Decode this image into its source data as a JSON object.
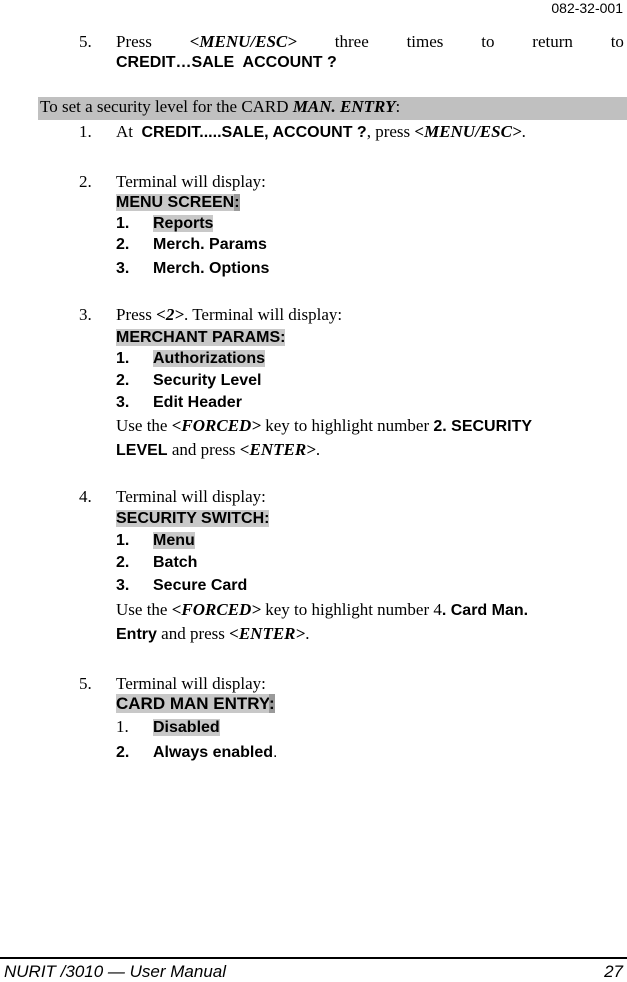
{
  "header": {
    "doc_number": "082-32-001"
  },
  "intro_step": {
    "number": "5.",
    "words": [
      "Press",
      "<MENU/ESC>",
      "three",
      "times",
      "to",
      "return",
      "to"
    ],
    "target": "CREDIT…SALE  ACCOUNT ?"
  },
  "section_banner": {
    "prefix": "To set a security level for the CARD ",
    "emphasis": "MAN. ENTRY",
    "suffix": ":"
  },
  "steps": [
    {
      "number": "1.",
      "text_prefix": "At  ",
      "bold": "CREDIT.....SALE, ACCOUNT ?",
      "text_mid": ", press ",
      "key": "<MENU/ESC>",
      "text_suffix": "."
    },
    {
      "number": "2.",
      "text": "Terminal will display:",
      "screen_title": "MENU SCREEN",
      "screen_colon": ":",
      "items": [
        {
          "n": "1.",
          "label": "Reports",
          "highlighted": true
        },
        {
          "n": "2.",
          "label": "Merch. Params",
          "highlighted": false
        },
        {
          "n": "3.",
          "label": "Merch. Options",
          "highlighted": false
        }
      ]
    },
    {
      "number": "3.",
      "text_prefix": "Press ",
      "key": "<2>",
      "text_suffix": ". Terminal will display:",
      "screen_title": "MERCHANT PARAMS:",
      "items": [
        {
          "n": "1.",
          "label": "Authorizations",
          "highlighted": true
        },
        {
          "n": "2.",
          "label": "Security Level",
          "highlighted": false
        },
        {
          "n": "3.",
          "label": "Edit Header",
          "highlighted": false
        }
      ],
      "instruction": {
        "a": "Use the ",
        "key1": "<FORCED>",
        "b": " key to highlight number ",
        "bold1": "2. SECURITY",
        "bold2": "LEVEL",
        "c": " and press ",
        "key2": "<ENTER>",
        "d": "."
      }
    },
    {
      "number": "4.",
      "text": "Terminal will display:",
      "screen_title": "SECURITY SWITCH:",
      "items": [
        {
          "n": "1.",
          "label": "Menu",
          "highlighted": true
        },
        {
          "n": "2.",
          "label": "Batch",
          "highlighted": false
        },
        {
          "n": "3.",
          "label": "Secure Card",
          "highlighted": false
        }
      ],
      "instruction": {
        "a": "Use the ",
        "key1": "<FORCED>",
        "b": " key to highlight number 4",
        "bold1": ". Card Man.",
        "bold2": "Entry",
        "c": " and press ",
        "key2": "<ENTER>",
        "d": "."
      }
    },
    {
      "number": "5.",
      "text": "Terminal will display:",
      "screen_title": "CARD MAN ENTRY",
      "screen_colon": ":",
      "items": [
        {
          "n": "1.",
          "label": "Disabled",
          "highlighted": true
        },
        {
          "n": "2.",
          "label": "Always enabled",
          "highlighted": false,
          "trail": "."
        }
      ]
    }
  ],
  "footer": {
    "title": "NURIT /3010 — User Manual",
    "page": "27"
  }
}
